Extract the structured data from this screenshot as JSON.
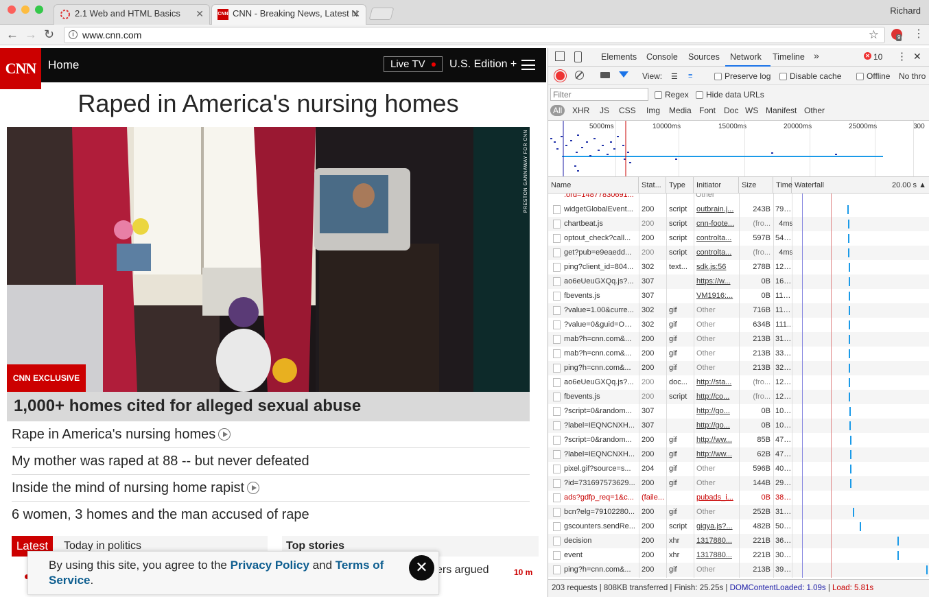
{
  "browser": {
    "profile_name": "Richard",
    "tabs": [
      {
        "title": "2.1 Web and HTML Basics",
        "active": false
      },
      {
        "title": "CNN - Breaking News, Latest N",
        "active": true
      }
    ],
    "url": "www.cnn.com",
    "extension_badge": "9"
  },
  "cnn": {
    "logo": "CNN",
    "nav_home": "Home",
    "live_tv": "Live TV",
    "edition": "U.S. Edition +",
    "headline": "Raped in America's nursing homes",
    "photo_credit": "PRESTON GANNAWAY FOR CNN",
    "exclusive_badge": "CNN EXCLUSIVE",
    "hero_caption": "1,000+ homes cited for alleged sexual abuse",
    "stories": [
      "Rape in America's nursing homes",
      "My mother was raped at 88 -- but never defeated",
      "Inside the mind of nursing home rapist",
      "6 women, 3 homes and the man accused of rape"
    ],
    "latest_label": "Latest",
    "today_politics": "Today in politics",
    "top_stories": "Top stories",
    "partial_story": "ers argued",
    "time_ago": "10 m",
    "cookie_prefix": "By using this site, you agree to the",
    "privacy_policy": "Privacy Policy",
    "cookie_and": "and",
    "terms_of": "Terms of",
    "terms_service": "Service",
    "cookie_period": "."
  },
  "devtools": {
    "tabs": [
      "Elements",
      "Console",
      "Sources",
      "Network",
      "Timeline"
    ],
    "active_tab": "Network",
    "more_tabs": "»",
    "error_count": "10",
    "view_label": "View:",
    "preserve_log": "Preserve log",
    "disable_cache": "Disable cache",
    "offline": "Offline",
    "throttle": "No thro",
    "filter_placeholder": "Filter",
    "regex": "Regex",
    "hide_data_urls": "Hide data URLs",
    "type_filters": [
      "All",
      "XHR",
      "JS",
      "CSS",
      "Img",
      "Media",
      "Font",
      "Doc",
      "WS",
      "Manifest",
      "Other"
    ],
    "timeline_ticks": [
      "5000ms",
      "10000ms",
      "15000ms",
      "20000ms",
      "25000ms",
      "300"
    ],
    "columns": {
      "name": "Name",
      "status": "Stat...",
      "type": "Type",
      "initiator": "Initiator",
      "size": "Size",
      "time": "Time",
      "waterfall": "Waterfall",
      "waterfall_scale": "20.00 s"
    },
    "requests": [
      {
        "name": "widgetGlobalEvent...",
        "status": "200",
        "type": "script",
        "initiator": "outbrain.j...",
        "size": "243B",
        "time": "79ms",
        "failed": false,
        "ilink": true,
        "wf": 0.41
      },
      {
        "name": "chartbeat.js",
        "status": "200",
        "type": "script",
        "initiator": "cnn-foote...",
        "size": "(fro...",
        "time": "4ms",
        "failed": false,
        "ilink": true,
        "wf": 0.415
      },
      {
        "name": "optout_check?call...",
        "status": "200",
        "type": "script",
        "initiator": "controlta...",
        "size": "597B",
        "time": "54ms",
        "failed": false,
        "ilink": true,
        "wf": 0.415
      },
      {
        "name": "get?pub=e9eaedd...",
        "status": "200",
        "type": "script",
        "initiator": "controlta...",
        "size": "(fro...",
        "time": "4ms",
        "failed": false,
        "ilink": true,
        "wf": 0.415
      },
      {
        "name": "ping?client_id=804...",
        "status": "302",
        "type": "text...",
        "initiator": "sdk.js:56",
        "size": "278B",
        "time": "123...",
        "failed": false,
        "ilink": true,
        "wf": 0.42
      },
      {
        "name": "ao6eUeuGXQq.js?...",
        "status": "307",
        "type": "",
        "initiator": "https://w...",
        "size": "0B",
        "time": "163...",
        "failed": false,
        "ilink": true,
        "wf": 0.42
      },
      {
        "name": "fbevents.js",
        "status": "307",
        "type": "",
        "initiator": "VM1916:...",
        "size": "0B",
        "time": "113...",
        "failed": false,
        "ilink": true,
        "wf": 0.42
      },
      {
        "name": "?value=1.00&curre...",
        "status": "302",
        "type": "gif",
        "initiator": "Other",
        "size": "716B",
        "time": "113...",
        "failed": false,
        "ilink": false,
        "wf": 0.42
      },
      {
        "name": "?value=0&guid=ON...",
        "status": "302",
        "type": "gif",
        "initiator": "Other",
        "size": "634B",
        "time": "111...",
        "failed": false,
        "ilink": false,
        "wf": 0.42
      },
      {
        "name": "mab?h=cnn.com&...",
        "status": "200",
        "type": "gif",
        "initiator": "Other",
        "size": "213B",
        "time": "31ms",
        "failed": false,
        "ilink": false,
        "wf": 0.42
      },
      {
        "name": "mab?h=cnn.com&...",
        "status": "200",
        "type": "gif",
        "initiator": "Other",
        "size": "213B",
        "time": "33ms",
        "failed": false,
        "ilink": false,
        "wf": 0.42
      },
      {
        "name": "ping?h=cnn.com&...",
        "status": "200",
        "type": "gif",
        "initiator": "Other",
        "size": "213B",
        "time": "32ms",
        "failed": false,
        "ilink": false,
        "wf": 0.42
      },
      {
        "name": "ao6eUeuGXQq.js?...",
        "status": "200",
        "type": "doc...",
        "initiator": "http://sta...",
        "size": "(fro...",
        "time": "12ms",
        "failed": false,
        "ilink": true,
        "wf": 0.42
      },
      {
        "name": "fbevents.js",
        "status": "200",
        "type": "script",
        "initiator": "http://co...",
        "size": "(fro...",
        "time": "12ms",
        "failed": false,
        "ilink": true,
        "wf": 0.42
      },
      {
        "name": "?script=0&random...",
        "status": "307",
        "type": "",
        "initiator": "http://go...",
        "size": "0B",
        "time": "108...",
        "failed": false,
        "ilink": true,
        "wf": 0.425
      },
      {
        "name": "?label=IEQNCNXH...",
        "status": "307",
        "type": "",
        "initiator": "http://go...",
        "size": "0B",
        "time": "108...",
        "failed": false,
        "ilink": true,
        "wf": 0.425
      },
      {
        "name": "?script=0&random...",
        "status": "200",
        "type": "gif",
        "initiator": "http://ww...",
        "size": "85B",
        "time": "47ms",
        "failed": false,
        "ilink": true,
        "wf": 0.43
      },
      {
        "name": "?label=IEQNCNXH...",
        "status": "200",
        "type": "gif",
        "initiator": "http://ww...",
        "size": "62B",
        "time": "47ms",
        "failed": false,
        "ilink": true,
        "wf": 0.43
      },
      {
        "name": "pixel.gif?source=s...",
        "status": "204",
        "type": "gif",
        "initiator": "Other",
        "size": "596B",
        "time": "40ms",
        "failed": false,
        "ilink": false,
        "wf": 0.43
      },
      {
        "name": "?id=731697573629...",
        "status": "200",
        "type": "gif",
        "initiator": "Other",
        "size": "144B",
        "time": "29ms",
        "failed": false,
        "ilink": false,
        "wf": 0.43
      },
      {
        "name": "ads?gdfp_req=1&c...",
        "status": "(faile...",
        "type": "",
        "initiator": "pubads_i...",
        "size": "0B",
        "time": "389...",
        "failed": true,
        "ilink": true,
        "wf": 0
      },
      {
        "name": "bcn?elg=79102280...",
        "status": "200",
        "type": "gif",
        "initiator": "Other",
        "size": "252B",
        "time": "313...",
        "failed": false,
        "ilink": false,
        "wf": 0.45
      },
      {
        "name": "gscounters.sendRe...",
        "status": "200",
        "type": "script",
        "initiator": "gigya.js?...",
        "size": "482B",
        "time": "50ms",
        "failed": false,
        "ilink": true,
        "wf": 0.5
      },
      {
        "name": "decision",
        "status": "200",
        "type": "xhr",
        "initiator": "1317880...",
        "size": "221B",
        "time": "36ms",
        "failed": false,
        "ilink": true,
        "wf": 0.78
      },
      {
        "name": "event",
        "status": "200",
        "type": "xhr",
        "initiator": "1317880...",
        "size": "221B",
        "time": "30ms",
        "failed": false,
        "ilink": true,
        "wf": 0.78
      },
      {
        "name": "ping?h=cnn.com&...",
        "status": "200",
        "type": "gif",
        "initiator": "Other",
        "size": "213B",
        "time": "39ms",
        "failed": false,
        "ilink": false,
        "wf": 0.99
      }
    ],
    "status": {
      "requests": "203 requests",
      "transferred": "808KB transferred",
      "finish": "Finish: 25.25s",
      "dom_content_loaded": "DOMContentLoaded: 1.09s",
      "load": "Load: 5.81s"
    },
    "colors": {
      "blue": "#1a1aa6",
      "red": "#c80000",
      "accent": "#1a73e8"
    }
  }
}
